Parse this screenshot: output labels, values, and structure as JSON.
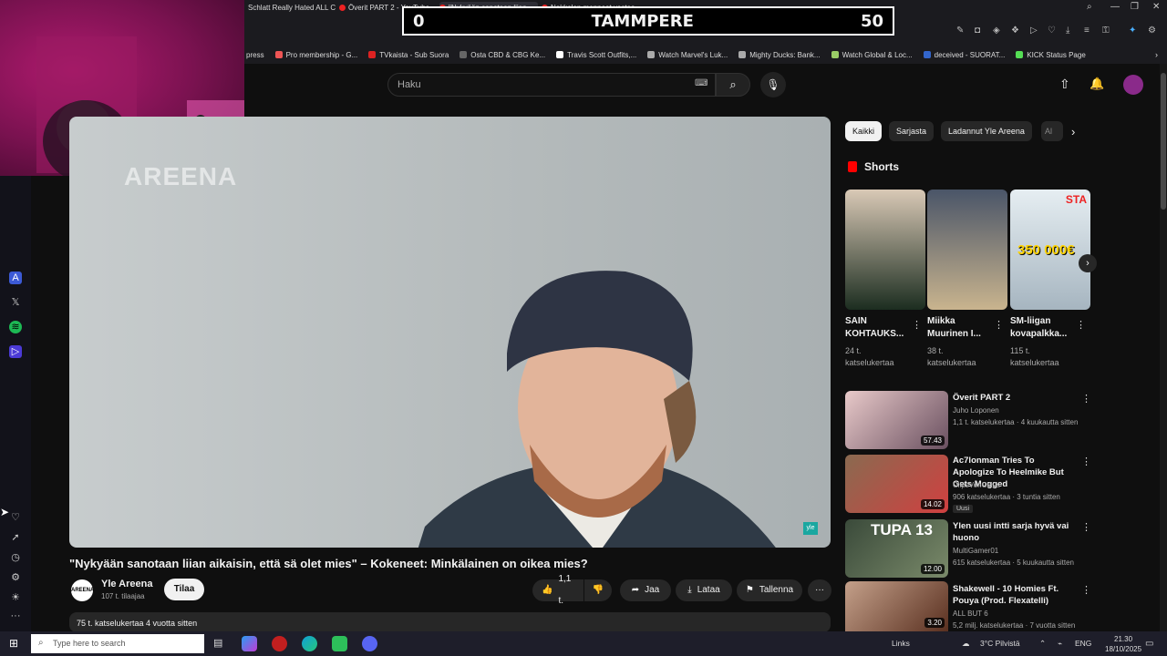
{
  "browser": {
    "tabs": [
      {
        "label": "Schlatt Really Hated ALL C"
      },
      {
        "label": "Överit PART 2 - YouTube"
      },
      {
        "label": "\"Nykyään sanotaan liian"
      },
      {
        "label": "Nokkelan menneet vastaa"
      }
    ],
    "bookmarks": [
      "press",
      "Pro membership - G...",
      "TVkaista - Sub Suora",
      "Osta CBD & CBG Ke...",
      "Travis Scott Outfits,...",
      "Watch Marvel's Luk...",
      "Mighty Ducks: Bank...",
      "Watch Global & Loc...",
      "deceived - SUORAT...",
      "KICK Status Page"
    ]
  },
  "score": {
    "left": "0",
    "center": "TAMMPERE",
    "right": "50"
  },
  "header": {
    "search_placeholder": "Haku"
  },
  "video": {
    "watermark": "AREENA",
    "corner_badge": "yle",
    "title": "\"Nykyään sanotaan liian aikaisin, että sä olet mies\" – Kokeneet: Minkälainen on oikea mies?",
    "channel": "Yle Areena",
    "channel_logo": "AREENA",
    "subscribers": "107 t. tilaajaa",
    "subscribe_label": "Tilaa",
    "likes": "1,1 t.",
    "share_label": "Jaa",
    "download_label": "Lataa",
    "save_label": "Tallenna",
    "more_label": "···",
    "description_meta": "75 t. katselukertaa  4 vuotta sitten"
  },
  "chips": [
    "Kaikki",
    "Sarjasta",
    "Ladannut Yle Areena",
    "Al"
  ],
  "shorts": {
    "heading": "Shorts",
    "items": [
      {
        "title": "SAIN KOHTAUKS...",
        "views": "24 t. katselukertaa",
        "colors": [
          "#d9c9b6",
          "#1c2d20"
        ]
      },
      {
        "title": "Miikka Muurinen I...",
        "views": "38 t. katselukertaa",
        "colors": [
          "#4a5568",
          "#c9b48e"
        ]
      },
      {
        "title": "SM-liigan kovapalkka...",
        "views": "115 t. katselukertaa",
        "colors": [
          "#e6eef2",
          "#a6b5c0"
        ],
        "overlay": "350 000€",
        "tag": "STA"
      }
    ]
  },
  "recommendations": [
    {
      "title": "Överit PART 2",
      "channel": "Juho Loponen",
      "meta": "1,1 t. katselukertaa · 4 kuukautta sitten",
      "duration": "57.43",
      "colors": [
        "#e8c9c9",
        "#6a5060"
      ]
    },
    {
      "title": "Ac7lonman Tries To Apologize To Heelmike But Gets Mogged",
      "channel": "ClipsVonClaus",
      "meta": "906 katselukertaa · 3 tuntia sitten",
      "badge": "Uusi",
      "duration": "14.02",
      "colors": [
        "#8a6a50",
        "#d04040"
      ]
    },
    {
      "title": "Ylen uusi intti sarja hyvä vai huono",
      "channel": "MultiGamer01",
      "meta": "615 katselukertaa · 5 kuukautta sitten",
      "duration": "12.00",
      "overlay": "TUPA 13",
      "colors": [
        "#3a4a3a",
        "#7a8a6a"
      ]
    },
    {
      "title": "Shakewell - 10 Homies Ft. Pouya (Prod. Flexatelli)",
      "channel": "ALL BUT 6",
      "meta": "5,2 milj. katselukertaa · 7 vuotta sitten",
      "duration": "3.20",
      "colors": [
        "#c4a08a",
        "#5a3020"
      ]
    }
  ],
  "taskbar": {
    "search_placeholder": "Type here to search",
    "links": "Links",
    "weather": "3°C  Pilvistä",
    "lang": "ENG",
    "time": "21.30",
    "date": "18/10/2025"
  }
}
